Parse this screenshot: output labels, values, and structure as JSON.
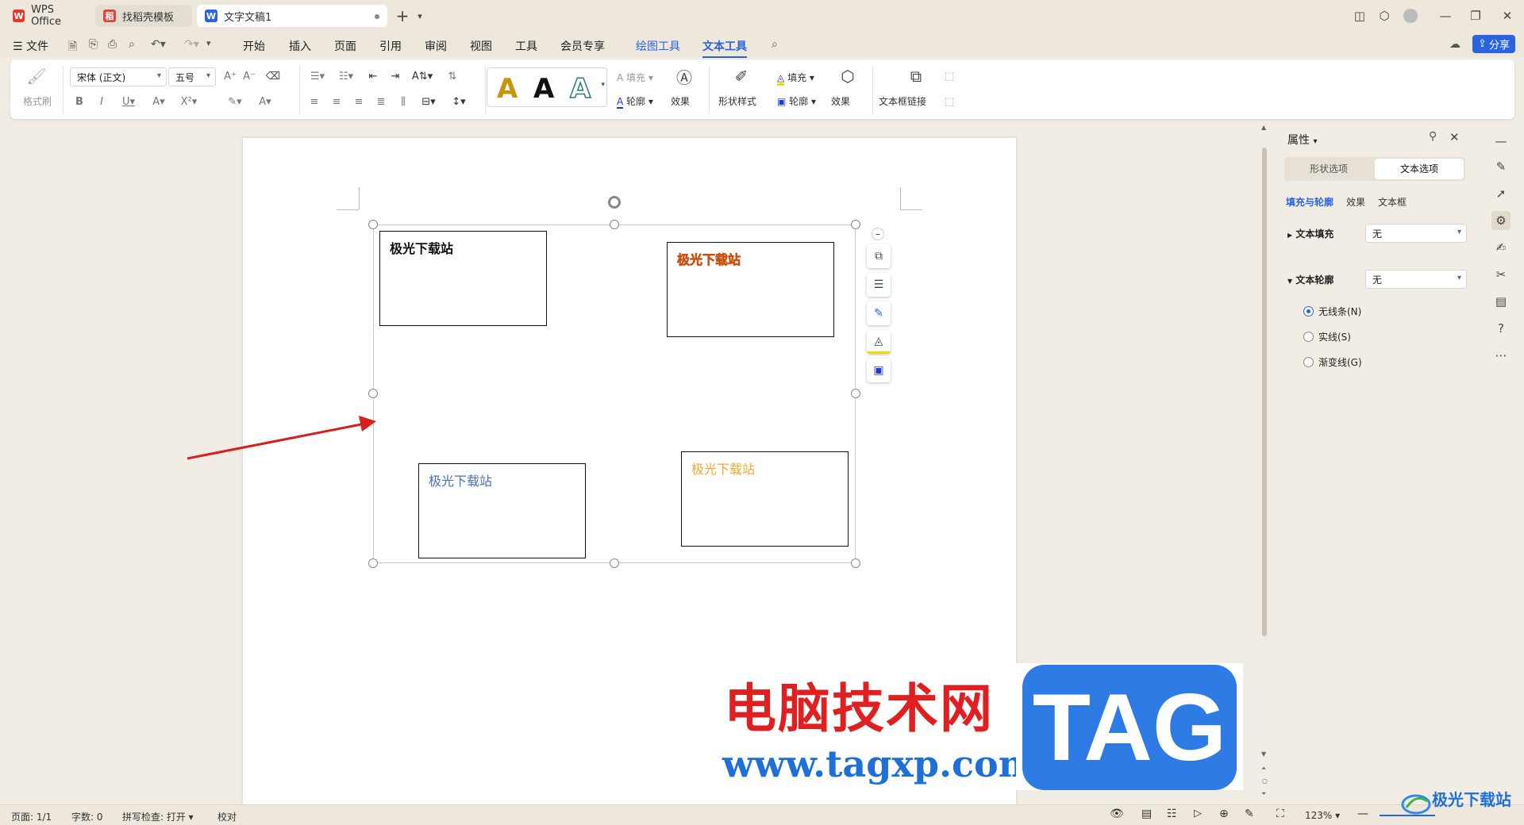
{
  "tabs": [
    {
      "label": "WPS Office",
      "icon": "wps-logo-icon"
    },
    {
      "label": "找稻壳模板",
      "icon": "docer-icon"
    },
    {
      "label": "文字文稿1",
      "icon": "writer-doc-icon"
    }
  ],
  "menu": {
    "file": "文件",
    "items": [
      "开始",
      "插入",
      "页面",
      "引用",
      "审阅",
      "视图",
      "工具",
      "会员专享"
    ],
    "drawing_tools": "绘图工具",
    "text_tools": "文本工具",
    "share": "分享"
  },
  "ribbon": {
    "format_painter": "格式刷",
    "font_name": "宋体 (正文)",
    "font_size": "五号",
    "text_fill": "填充",
    "text_outline": "轮廓",
    "text_effect": "效果",
    "shape_style": "形状样式",
    "shape_fill": "填充",
    "shape_outline": "轮廓",
    "shape_effect": "效果",
    "textbox_link": "文本框链接",
    "style_preview": [
      "A",
      "A",
      "A"
    ]
  },
  "document": {
    "boxes": [
      {
        "text": "极光下载站",
        "color": "#111111"
      },
      {
        "text": "极光下载站",
        "color": "#e8701c"
      },
      {
        "text": "极光下载站",
        "color": "#4a6fb5"
      },
      {
        "text": "极光下载站",
        "color": "#f0a830"
      }
    ]
  },
  "panel": {
    "title": "属性",
    "tab_shape": "形状选项",
    "tab_text": "文本选项",
    "subtabs": [
      "填充与轮廓",
      "效果",
      "文本框"
    ],
    "text_fill_label": "文本填充",
    "text_fill_value": "无",
    "text_outline_label": "文本轮廓",
    "text_outline_value": "无",
    "radios": [
      "无线条(N)",
      "实线(S)",
      "渐变线(G)"
    ]
  },
  "status": {
    "page": "页面: 1/1",
    "words": "字数: 0",
    "spell": "拼写检查: 打开",
    "proof": "校对",
    "zoom": "123%"
  },
  "watermark": {
    "cn": "电脑技术网",
    "url": "www.tagxp.com",
    "tag": "TAG",
    "jg": "极光下载站"
  },
  "colors": {
    "accent": "#2a64e0",
    "wm_red": "#e02020",
    "wm_blue": "#1f6fd8",
    "tag_bg": "#2f7be6"
  }
}
